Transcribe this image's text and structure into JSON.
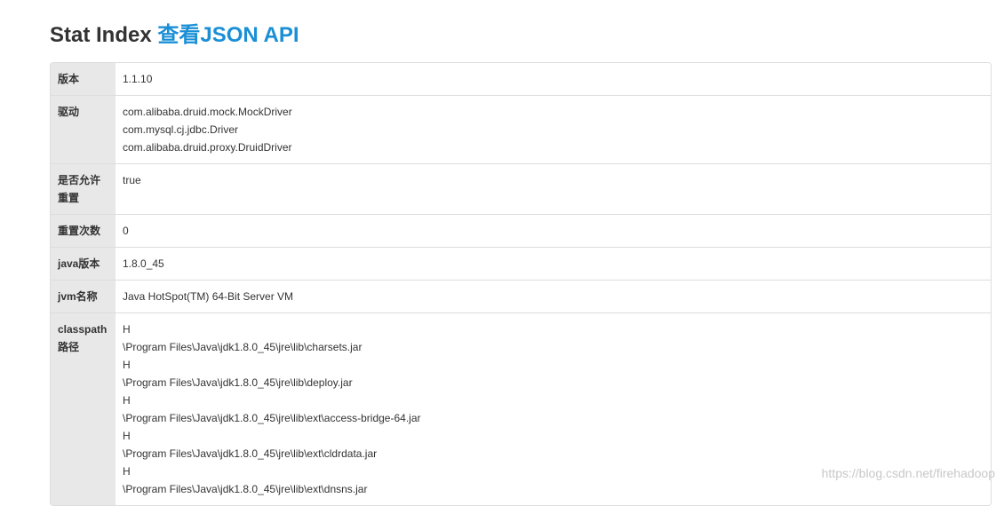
{
  "header": {
    "title": "Stat Index",
    "json_api_link": "查看JSON API"
  },
  "rows": [
    {
      "label": "版本",
      "values": [
        "1.1.10"
      ]
    },
    {
      "label": "驱动",
      "values": [
        "com.alibaba.druid.mock.MockDriver",
        "com.mysql.cj.jdbc.Driver",
        "com.alibaba.druid.proxy.DruidDriver"
      ]
    },
    {
      "label_lines": [
        "是否允许",
        "重置"
      ],
      "values": [
        "true"
      ]
    },
    {
      "label": "重置次数",
      "values": [
        "0"
      ]
    },
    {
      "label": "java版本",
      "values": [
        "1.8.0_45"
      ]
    },
    {
      "label": "jvm名称",
      "values": [
        "Java HotSpot(TM) 64-Bit Server VM"
      ]
    },
    {
      "label_lines": [
        "classpath",
        "路径"
      ],
      "values": [
        "H",
        "\\Program Files\\Java\\jdk1.8.0_45\\jre\\lib\\charsets.jar",
        "H",
        "\\Program Files\\Java\\jdk1.8.0_45\\jre\\lib\\deploy.jar",
        "H",
        "\\Program Files\\Java\\jdk1.8.0_45\\jre\\lib\\ext\\access-bridge-64.jar",
        "H",
        "\\Program Files\\Java\\jdk1.8.0_45\\jre\\lib\\ext\\cldrdata.jar",
        "H",
        "\\Program Files\\Java\\jdk1.8.0_45\\jre\\lib\\ext\\dnsns.jar"
      ]
    }
  ],
  "watermark": "https://blog.csdn.net/firehadoop"
}
